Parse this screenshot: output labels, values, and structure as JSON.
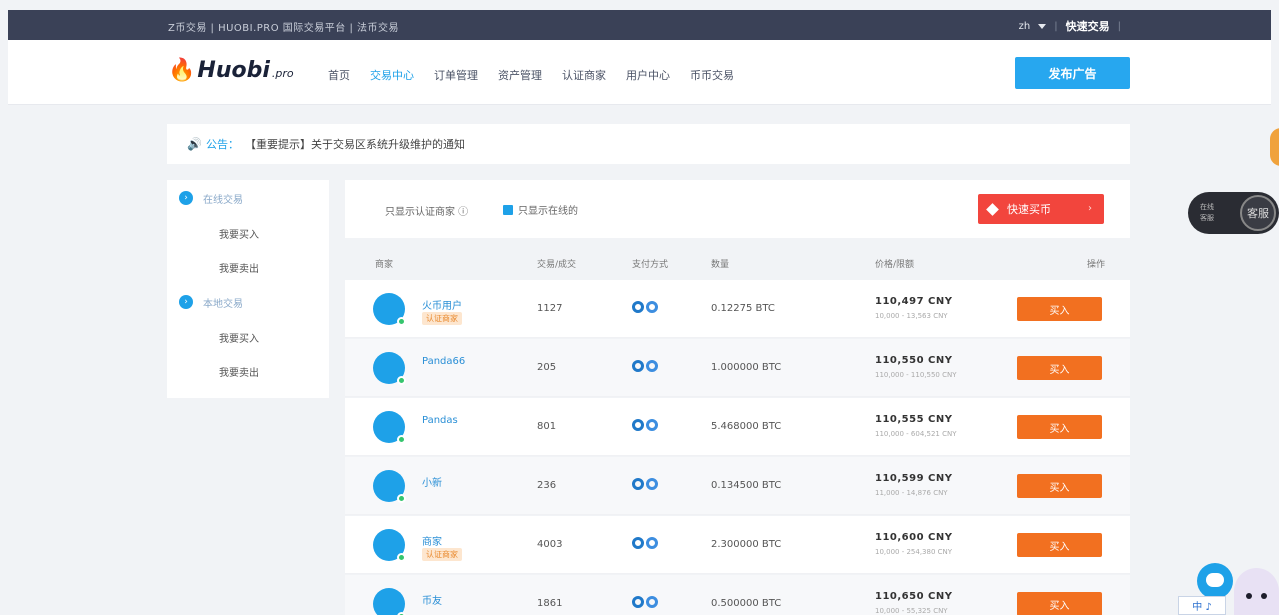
{
  "topbar": {
    "left_text": "Z币交易 | HUOBI.PRO 国际交易平台 | 法币交易",
    "lang": "zh",
    "fast_trade": "快速交易"
  },
  "header": {
    "logo_name": "Huobi",
    "logo_suffix": ".pro",
    "nav": [
      {
        "label": "首页",
        "active": false
      },
      {
        "label": "交易中心",
        "active": true
      },
      {
        "label": "订单管理",
        "active": false
      },
      {
        "label": "资产管理",
        "active": false
      },
      {
        "label": "认证商家",
        "active": false
      },
      {
        "label": "用户中心",
        "active": false
      },
      {
        "label": "币币交易",
        "active": false
      }
    ],
    "post_ad": "发布广告"
  },
  "notice": {
    "label": "公告：",
    "text": "【重要提示】关于交易区系统升级维护的通知"
  },
  "sidemenu": {
    "groups": [
      {
        "label": "在线交易",
        "items": [
          "我要买入",
          "我要卖出"
        ]
      },
      {
        "label": "本地交易",
        "items": [
          "我要买入",
          "我要卖出"
        ]
      }
    ]
  },
  "filter": {
    "text": "只显示认证商家 ⓘ",
    "check_label": "只显示在线的",
    "quick_button": "快速买币",
    "quick_arrow": "›"
  },
  "table": {
    "headers": [
      "商家",
      "交易/成交",
      "支付方式",
      "数量",
      "价格/限额",
      "操作"
    ],
    "rows": [
      {
        "merchant": "火币用户",
        "badge": "认证商家",
        "volume": "1127",
        "amount": "0.12275 BTC",
        "price": "110,497 CNY",
        "limit": "10,000 - 13,563 CNY",
        "action": "买入",
        "alt": false
      },
      {
        "merchant": "Panda66",
        "badge": "",
        "volume": "205",
        "amount": "1.000000 BTC",
        "price": "110,550 CNY",
        "limit": "110,000 - 110,550 CNY",
        "action": "买入",
        "alt": true
      },
      {
        "merchant": "Pandas",
        "badge": "",
        "volume": "801",
        "amount": "5.468000 BTC",
        "price": "110,555 CNY",
        "limit": "110,000 - 604,521 CNY",
        "action": "买入",
        "alt": false
      },
      {
        "merchant": "小新",
        "badge": "",
        "volume": "236",
        "amount": "0.134500 BTC",
        "price": "110,599 CNY",
        "limit": "11,000 - 14,876 CNY",
        "action": "买入",
        "alt": true
      },
      {
        "merchant": "商家",
        "badge": "认证商家",
        "volume": "4003",
        "amount": "2.300000 BTC",
        "price": "110,600 CNY",
        "limit": "10,000 - 254,380 CNY",
        "action": "买入",
        "alt": false
      },
      {
        "merchant": "币友",
        "badge": "",
        "volume": "1861",
        "amount": "0.500000 BTC",
        "price": "110,650 CNY",
        "limit": "10,000 - 55,325 CNY",
        "action": "买入",
        "alt": true
      }
    ]
  },
  "floaters": {
    "pill_text_1": "在线",
    "pill_text_2": "客服",
    "pill_circle": "客服",
    "ime": "中 ♪"
  }
}
